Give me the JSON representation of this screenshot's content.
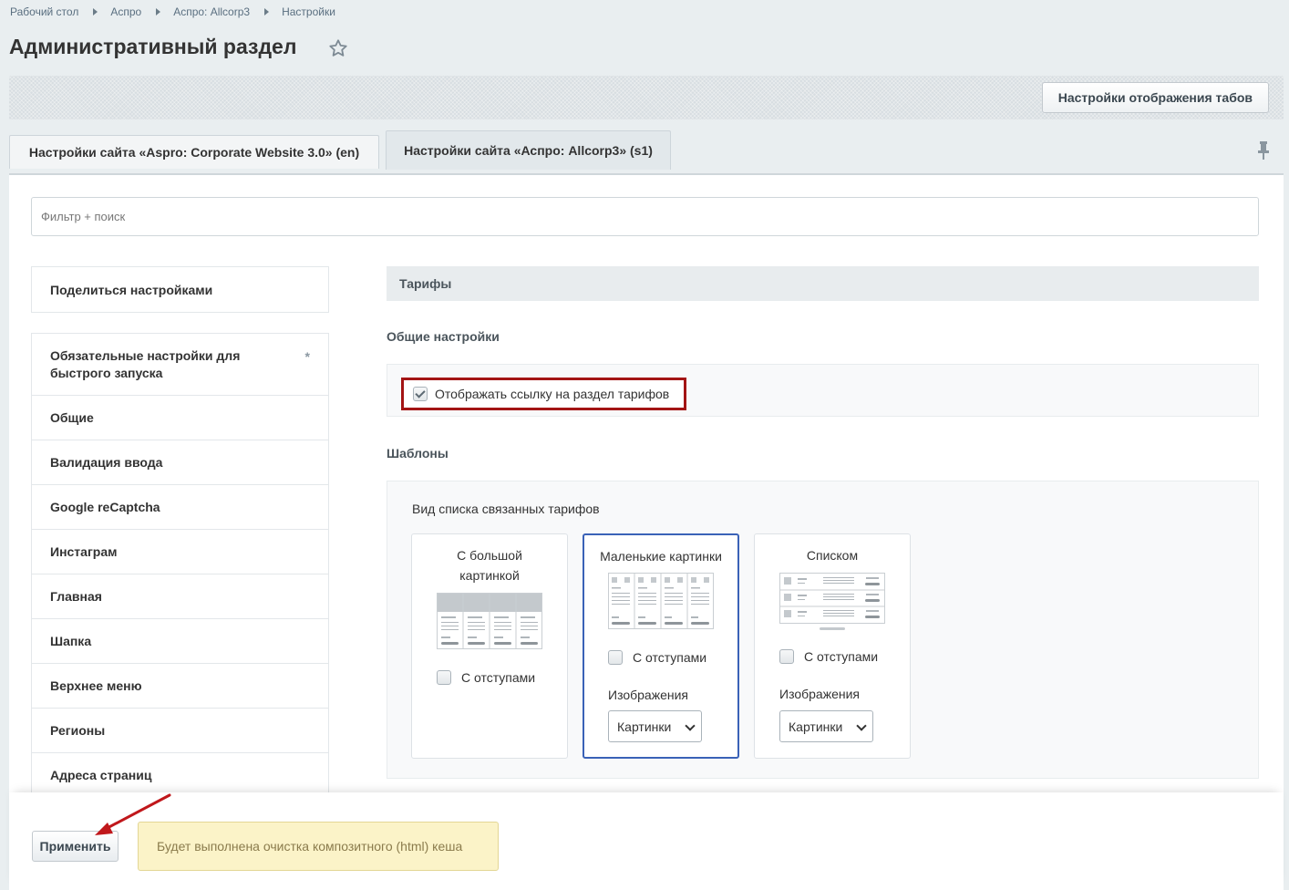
{
  "breadcrumb": [
    "Рабочий стол",
    "Аспро",
    "Аспро: Allcorp3",
    "Настройки"
  ],
  "page_title": "Административный раздел",
  "toolbar": {
    "tab_settings_label": "Настройки отображения табов"
  },
  "tabs": [
    {
      "label": "Настройки сайта «Aspro: Corporate Website 3.0» (en)"
    },
    {
      "label": "Настройки сайта «Аспро: Allcorp3» (s1)"
    }
  ],
  "filter": {
    "placeholder": "Фильтр + поиск"
  },
  "sidebar": {
    "share_label": "Поделиться настройками",
    "required_marker": "*",
    "items": [
      {
        "label": "Обязательные настройки для быстрого запуска"
      },
      {
        "label": "Общие"
      },
      {
        "label": "Валидация ввода"
      },
      {
        "label": "Google reCaptcha"
      },
      {
        "label": "Инстаграм"
      },
      {
        "label": "Главная"
      },
      {
        "label": "Шапка"
      },
      {
        "label": "Верхнее меню"
      },
      {
        "label": "Регионы"
      },
      {
        "label": "Адреса страниц"
      }
    ]
  },
  "main": {
    "section_title": "Тарифы",
    "general_title": "Общие настройки",
    "show_link_label": "Отображать ссылку на раздел тарифов",
    "templates_title": "Шаблоны",
    "list_view_title": "Вид списка связанных тарифов",
    "cards": [
      {
        "title": "С большой картинкой",
        "padding_label": "С отступами"
      },
      {
        "title": "Маленькие картинки",
        "padding_label": "С отступами",
        "images_label": "Изображения",
        "select_value": "Картинки"
      },
      {
        "title": "Списком",
        "padding_label": "С отступами",
        "images_label": "Изображения",
        "select_value": "Картинки"
      }
    ]
  },
  "footer": {
    "apply_label": "Применить",
    "notice": "Будет выполнена очистка композитного (html) кеша"
  },
  "colors": {
    "highlight": "#a31414",
    "selected_card": "#3a62b7",
    "notice_bg": "#fbf3c8"
  }
}
